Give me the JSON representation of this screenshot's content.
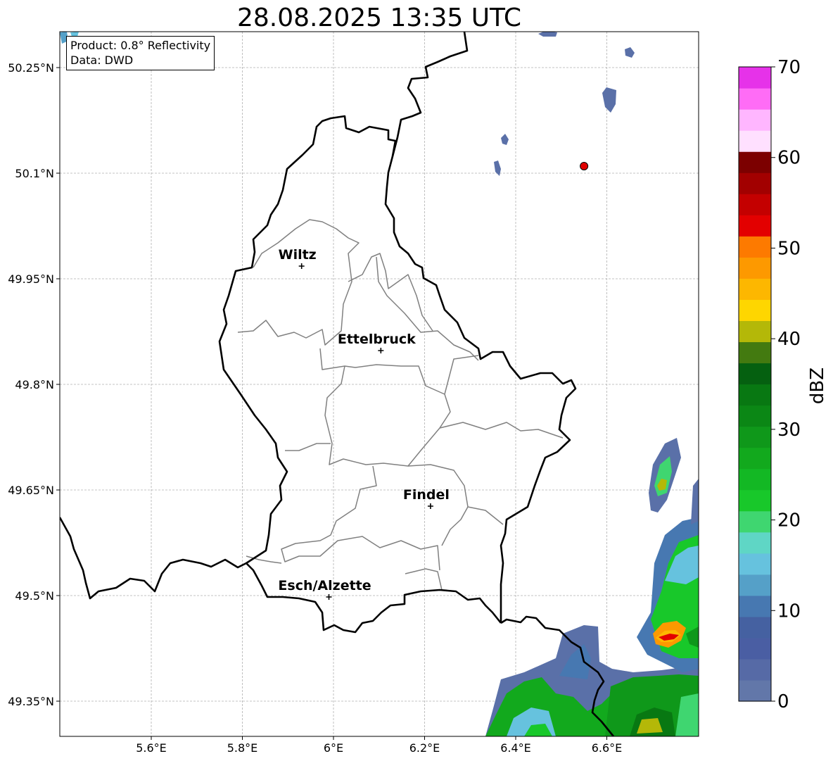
{
  "title": "28.08.2025 13:35 UTC",
  "info": {
    "product": "Product: 0.8° Reflectivity",
    "source": "Data: DWD"
  },
  "map": {
    "lon_range": [
      5.4,
      6.8
    ],
    "lat_range": [
      49.3,
      50.3
    ],
    "lon_ticks": [
      {
        "value": 5.6,
        "label": "5.6°E"
      },
      {
        "value": 5.8,
        "label": "5.8°E"
      },
      {
        "value": 6.0,
        "label": "6°E"
      },
      {
        "value": 6.2,
        "label": "6.2°E"
      },
      {
        "value": 6.4,
        "label": "6.4°E"
      },
      {
        "value": 6.6,
        "label": "6.6°E"
      }
    ],
    "lat_ticks": [
      {
        "value": 50.25,
        "label": "50.25°N"
      },
      {
        "value": 50.1,
        "label": "50.1°N"
      },
      {
        "value": 49.95,
        "label": "49.95°N"
      },
      {
        "value": 49.8,
        "label": "49.8°N"
      },
      {
        "value": 49.65,
        "label": "49.65°N"
      },
      {
        "value": 49.5,
        "label": "49.5°N"
      },
      {
        "value": 49.35,
        "label": "49.35°N"
      }
    ],
    "grid": true,
    "cities": [
      {
        "name": "Wiltz",
        "lon": 5.93,
        "lat": 49.968
      },
      {
        "name": "Ettelbruck",
        "lon": 6.104,
        "lat": 49.848
      },
      {
        "name": "Findel",
        "lon": 6.213,
        "lat": 49.627
      },
      {
        "name": "Esch/Alzette",
        "lon": 5.99,
        "lat": 49.498
      }
    ],
    "marker": {
      "lon": 6.55,
      "lat": 50.11,
      "color": "#e00000"
    }
  },
  "colorbar": {
    "label": "dBZ",
    "min": 0,
    "max": 70,
    "ticks": [
      {
        "value": 0,
        "label": "0"
      },
      {
        "value": 10,
        "label": "10"
      },
      {
        "value": 20,
        "label": "20"
      },
      {
        "value": 30,
        "label": "30"
      },
      {
        "value": 40,
        "label": "40"
      },
      {
        "value": 50,
        "label": "50"
      },
      {
        "value": 60,
        "label": "60"
      },
      {
        "value": 70,
        "label": "70"
      }
    ],
    "colors": [
      "#6277a9",
      "#566aa6",
      "#4a5ea3",
      "#4561a1",
      "#4778b1",
      "#55a0c8",
      "#66c2de",
      "#5fd6c5",
      "#3fd670",
      "#18c82a",
      "#13b824",
      "#12a91d",
      "#0f981a",
      "#0b8715",
      "#087812",
      "#056010",
      "#437a10",
      "#b4b808",
      "#fed600",
      "#fdb700",
      "#fd9900",
      "#fd7a00",
      "#e30000",
      "#c40000",
      "#a20000",
      "#7c0000",
      "#ffe0ff",
      "#ffb6ff",
      "#ff6cf6",
      "#e632e9"
    ]
  }
}
